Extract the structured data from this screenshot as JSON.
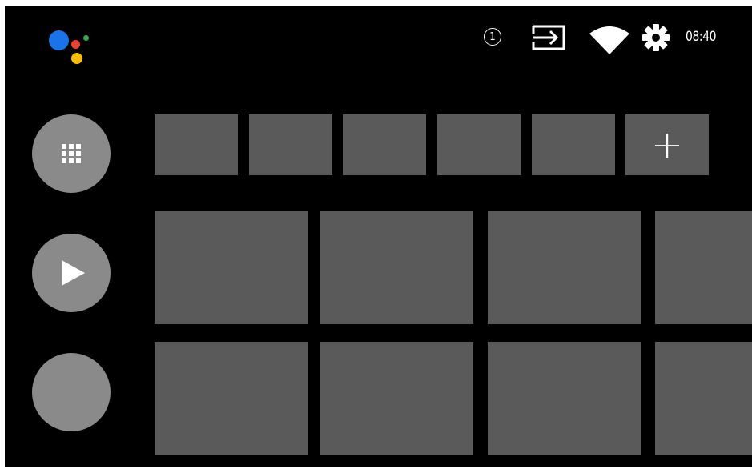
{
  "status_bar": {
    "notification_count": "1",
    "time": "08:40",
    "icons": [
      "input-source-icon",
      "wifi-icon",
      "settings-gear-icon"
    ]
  },
  "assistant": {
    "icon": "google-assistant-icon",
    "colors": [
      "#1a73e8",
      "#ea4335",
      "#fbbc04",
      "#34a853"
    ]
  },
  "sidebar": {
    "buttons": [
      {
        "name": "apps",
        "icon": "apps-grid-icon"
      },
      {
        "name": "play",
        "icon": "play-icon"
      },
      {
        "name": "blank",
        "icon": ""
      }
    ]
  },
  "favorites_row": {
    "tile_count": 6,
    "add_label": "+"
  },
  "colors": {
    "background": "#000000",
    "tile": "#5a5a5b",
    "circle_button": "#8a8a8b"
  }
}
